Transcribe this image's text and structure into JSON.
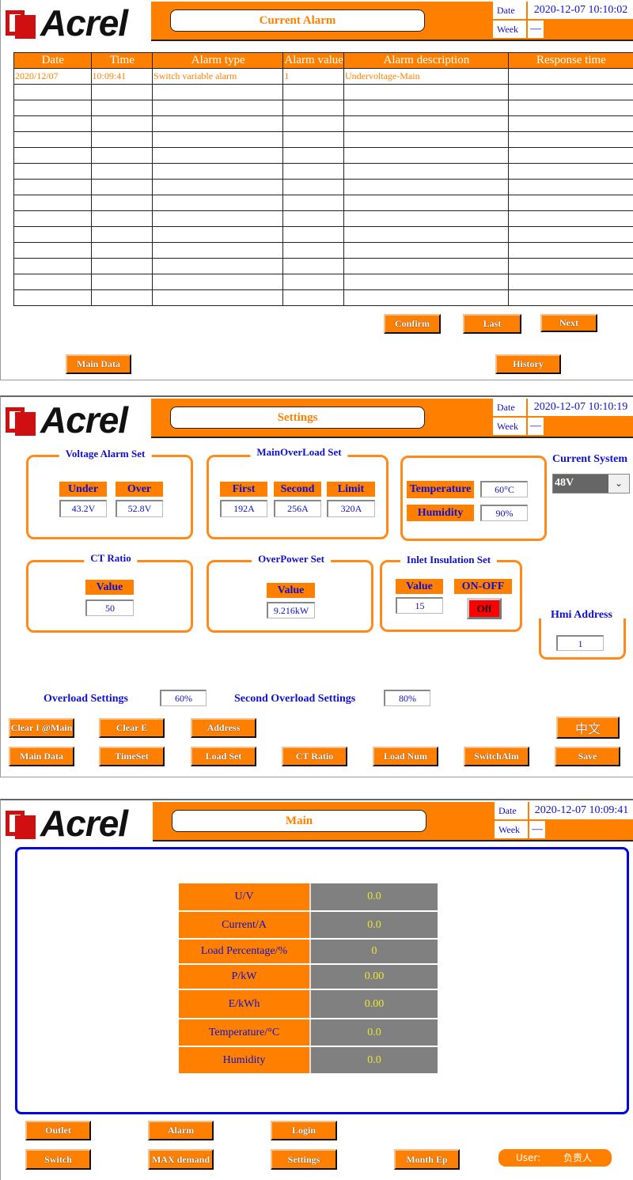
{
  "brand": {
    "logo_text": "Acrel"
  },
  "colors": {
    "accent": "#ff8000",
    "label_text": "#1010d0",
    "value_text": "#e8e830",
    "off_button": "#ff0000",
    "frame_blue": "#0000e0"
  },
  "header_common": {
    "date_label": "Date",
    "week_label": "Week",
    "week_value": "—"
  },
  "alarm_screen": {
    "title": "Current Alarm",
    "datetime": "2020-12-07 10:10:02",
    "columns": [
      "Date",
      "Time",
      "Alarm type",
      "Alarm value",
      "Alarm description",
      "Response time"
    ],
    "rows": [
      [
        "2020/12/07",
        "10:09:41",
        "Switch variable alarm",
        "1",
        "Undervoltage-Main",
        ""
      ]
    ],
    "buttons": {
      "confirm": "Confirm",
      "last": "Last",
      "next": "Next",
      "main_data": "Main Data",
      "history": "History"
    }
  },
  "settings_screen": {
    "title": "Settings",
    "datetime": "2020-12-07 10:10:19",
    "voltage_alarm": {
      "title": "Voltage Alarm Set",
      "under_label": "Under",
      "under_value": "43.2V",
      "over_label": "Over",
      "over_value": "52.8V"
    },
    "main_overload": {
      "title": "MainOverLoad Set",
      "first_label": "First",
      "first_value": "192A",
      "second_label": "Second",
      "second_value": "256A",
      "limit_label": "Limit",
      "limit_value": "320A"
    },
    "env": {
      "temperature_label": "Temperature",
      "temperature_value": "60°C",
      "humidity_label": "Humidity",
      "humidity_value": "90%"
    },
    "current_system": {
      "label": "Current System",
      "selected": "48V"
    },
    "ct_ratio": {
      "title": "CT Ratio",
      "value_label": "Value",
      "value": "50"
    },
    "over_power": {
      "title": "OverPower Set",
      "value_label": "Value",
      "value": "9.216kW"
    },
    "inlet_insulation": {
      "title": "Inlet Insulation Set",
      "value_label": "Value",
      "value": "15",
      "onoff_label": "ON-OFF",
      "onoff_state": "Off"
    },
    "hmi_address": {
      "title": "Hmi Address",
      "value": "1"
    },
    "overload_settings": {
      "label": "Overload Settings",
      "value": "60%",
      "second_label": "Second Overload Settings",
      "second_value": "80%"
    },
    "buttons": {
      "clear_i_main": "Clear I @Main",
      "clear_e": "Clear E",
      "address": "Address",
      "language": "中文",
      "main_data": "Main Data",
      "time_set": "TimeSet",
      "load_set": "Load Set",
      "ct_ratio": "CT Ratio",
      "load_num": "Load Num",
      "switch_alm": "SwitchAlm",
      "save": "Save"
    }
  },
  "main_screen": {
    "title": "Main",
    "datetime": "2020-12-07 10:09:41",
    "readings": [
      {
        "label": "U/V",
        "value": "0.0"
      },
      {
        "label": "Current/A",
        "value": "0.0"
      },
      {
        "label": "Load Percentage/%",
        "value": "0"
      },
      {
        "label": "P/kW",
        "value": "0.00"
      },
      {
        "label": "E/kWh",
        "value": "0.00"
      },
      {
        "label": "Temperature/°C",
        "value": "0.0"
      },
      {
        "label": "Humidity",
        "value": "0.0"
      }
    ],
    "buttons": {
      "outlet": "Outlet",
      "alarm": "Alarm",
      "login": "Login",
      "switch": "Switch",
      "max_demand": "MAX demand",
      "settings": "Settings",
      "month_ep": "Month Ep"
    },
    "user": {
      "label": "User:",
      "value": "负责人"
    }
  }
}
